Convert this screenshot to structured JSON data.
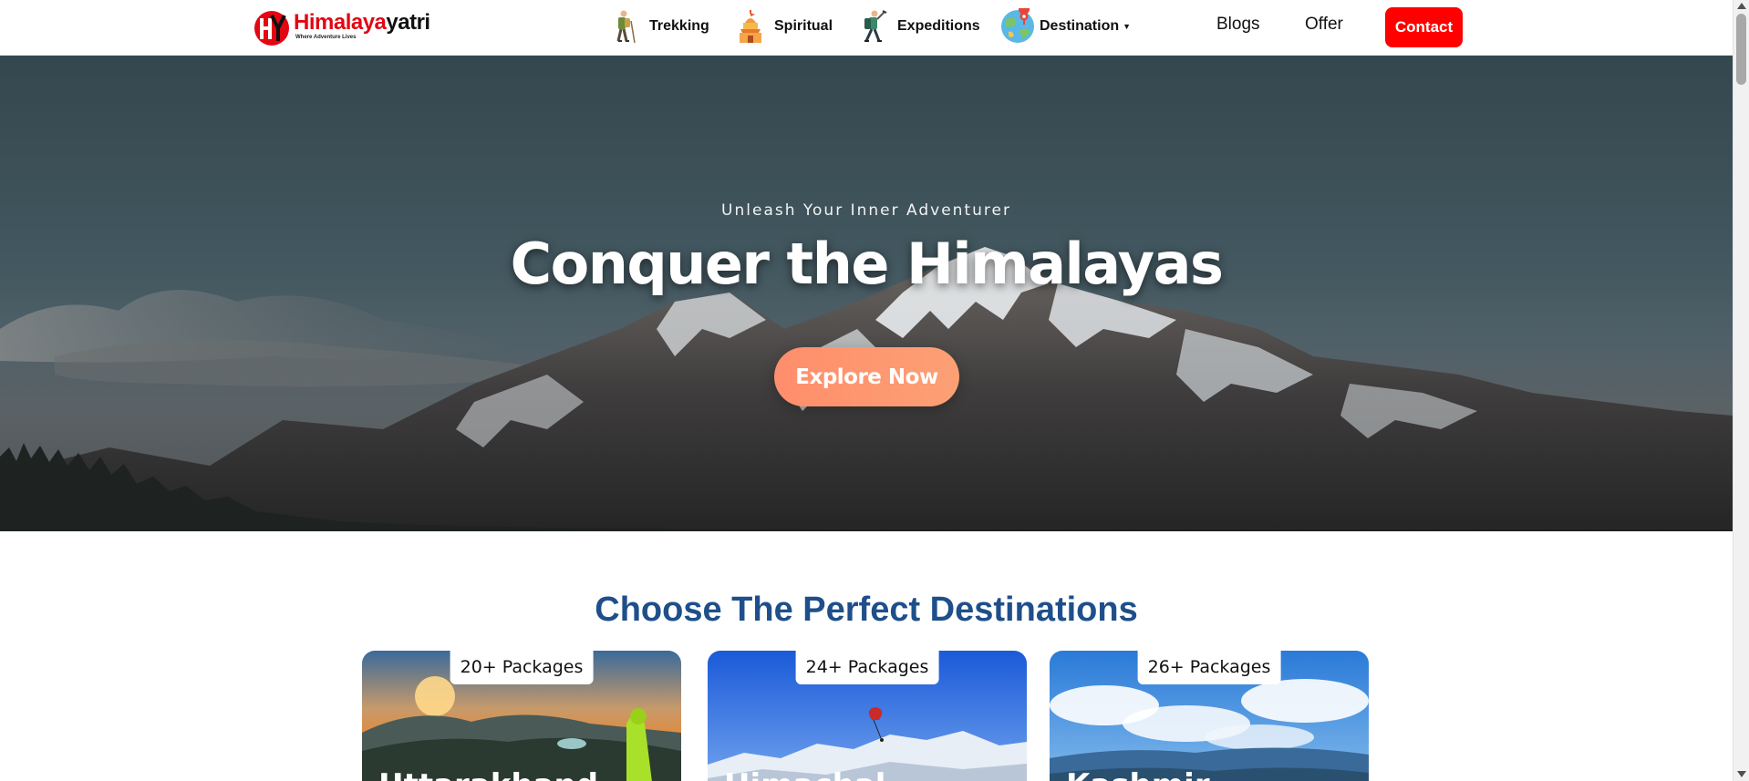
{
  "brand": {
    "name_part1": "Himalaya",
    "name_part2": "yatri",
    "tagline": "Where Adventure Lives",
    "logo_letters": "HY"
  },
  "nav": {
    "items": [
      {
        "label": "Trekking",
        "icon": "hiker-icon"
      },
      {
        "label": "Spiritual",
        "icon": "temple-icon"
      },
      {
        "label": "Expeditions",
        "icon": "climber-icon"
      },
      {
        "label": "Destination",
        "icon": "globe-pin-icon",
        "has_dropdown": true
      }
    ],
    "blogs": "Blogs",
    "offer": "Offer",
    "contact": "Contact"
  },
  "hero": {
    "subtitle": "Unleash Your Inner Adventurer",
    "title": "Conquer the Himalayas",
    "cta": "Explore Now"
  },
  "destinations": {
    "title": "Choose The Perfect Destinations",
    "cards": [
      {
        "badge": "20+ Packages",
        "title": "Uttarakhand"
      },
      {
        "badge": "24+ Packages",
        "title": "Himachal"
      },
      {
        "badge": "26+ Packages",
        "title": "Kashmir"
      }
    ]
  },
  "colors": {
    "brand_red": "#e30613",
    "contact_bg": "#ff0000",
    "section_title": "#1e4f8a",
    "cta_gradient_start": "#ff8e6c",
    "cta_gradient_end": "#fca074"
  }
}
